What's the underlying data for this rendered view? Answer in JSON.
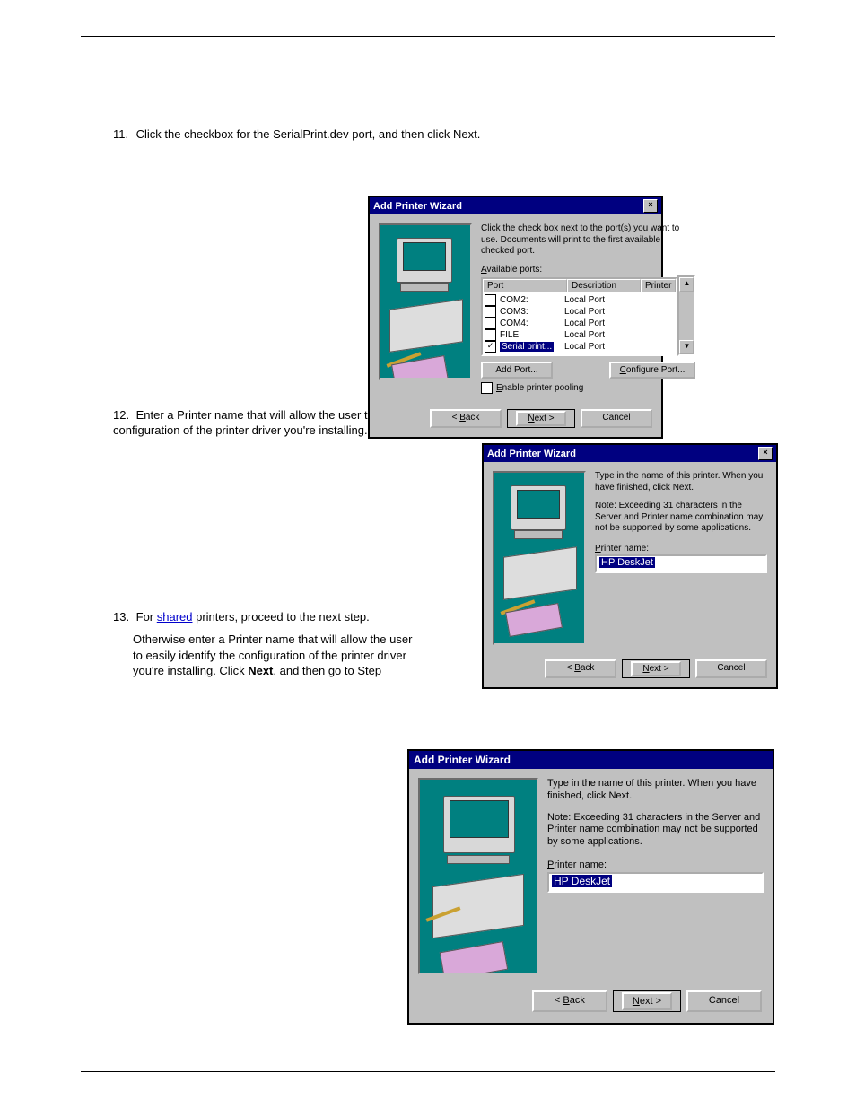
{
  "document": {
    "step11": {
      "num": "11.",
      "text": "Click the checkbox for the SerialPrint.dev port, and then click Next."
    },
    "step12": {
      "num": "12.",
      "text": "Enter a Printer name that will allow the user to easily identify the configuration of the printer driver you're installing. Click Next."
    },
    "step13a": {
      "num": "13.",
      "prefix": "For ",
      "link": "shared",
      "suffix": " printers, proceed to the next step."
    },
    "step13b_pre": "Otherwise enter a Printer name that will allow the user to easily identify the configuration of the printer driver you're installing. Click ",
    "step13b_btn": "Next",
    "step13b_post": ", and then go to Step "
  },
  "dlg": {
    "title": "Add Printer Wizard",
    "ports": {
      "instr": "Click the check box next to the port(s) you want to use. Documents will print to the first available checked port.",
      "avail_label": "Available ports:",
      "cols": {
        "port": "Port",
        "desc": "Description",
        "printer": "Printer"
      },
      "rows": [
        {
          "checked": false,
          "name": "COM2:",
          "desc": "Local Port"
        },
        {
          "checked": false,
          "name": "COM3:",
          "desc": "Local Port"
        },
        {
          "checked": false,
          "name": "COM4:",
          "desc": "Local Port"
        },
        {
          "checked": false,
          "name": "FILE:",
          "desc": "Local Port"
        },
        {
          "checked": true,
          "name": "Serial print...",
          "desc": "Local Port",
          "selected": true
        }
      ],
      "add_port": "Add Port...",
      "config_port": "Configure Port...",
      "pooling": "Enable printer pooling",
      "back": "< Back",
      "next": "Next >",
      "cancel": "Cancel"
    },
    "name": {
      "instr1": "Type in the name of this printer.  When you have finished, click Next.",
      "instr2": "Note:  Exceeding 31 characters in the Server and Printer name combination may not be supported by some applications.",
      "label": "Printer name:",
      "value": "HP DeskJet",
      "back": "< Back",
      "next": "Next >",
      "cancel": "Cancel"
    }
  }
}
